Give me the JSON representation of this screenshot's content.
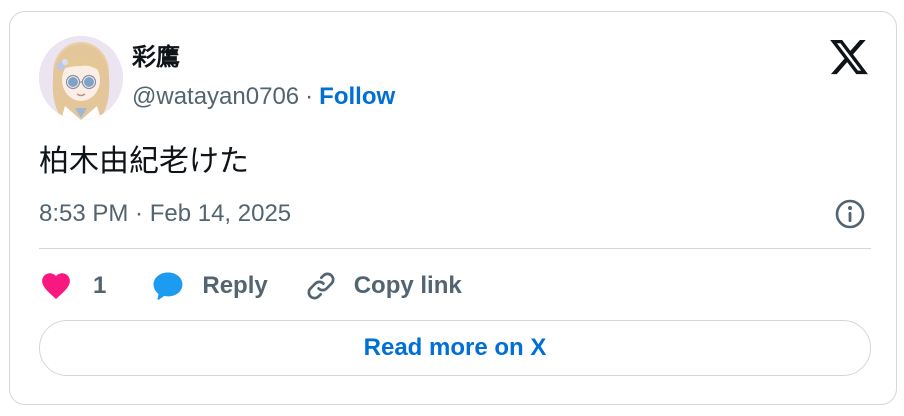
{
  "author": {
    "display_name": "彩鷹",
    "handle": "@watayan0706",
    "separator": "·",
    "follow_label": "Follow",
    "avatar_icon": "user-avatar-anime-girl"
  },
  "brand": {
    "logo_icon": "x-logo-icon"
  },
  "tweet": {
    "text": "柏木由紀老けた",
    "timestamp": "8:53 PM · Feb 14, 2025",
    "info_icon": "info-icon"
  },
  "actions": {
    "like_count": "1",
    "reply_label": "Reply",
    "copy_link_label": "Copy link"
  },
  "read_more_label": "Read more on X",
  "colors": {
    "like": "#f91880",
    "reply": "#1d9bf0",
    "link": "#006fd6",
    "text_primary": "#0f1419",
    "text_secondary": "#536471",
    "border": "#cfd9de"
  }
}
